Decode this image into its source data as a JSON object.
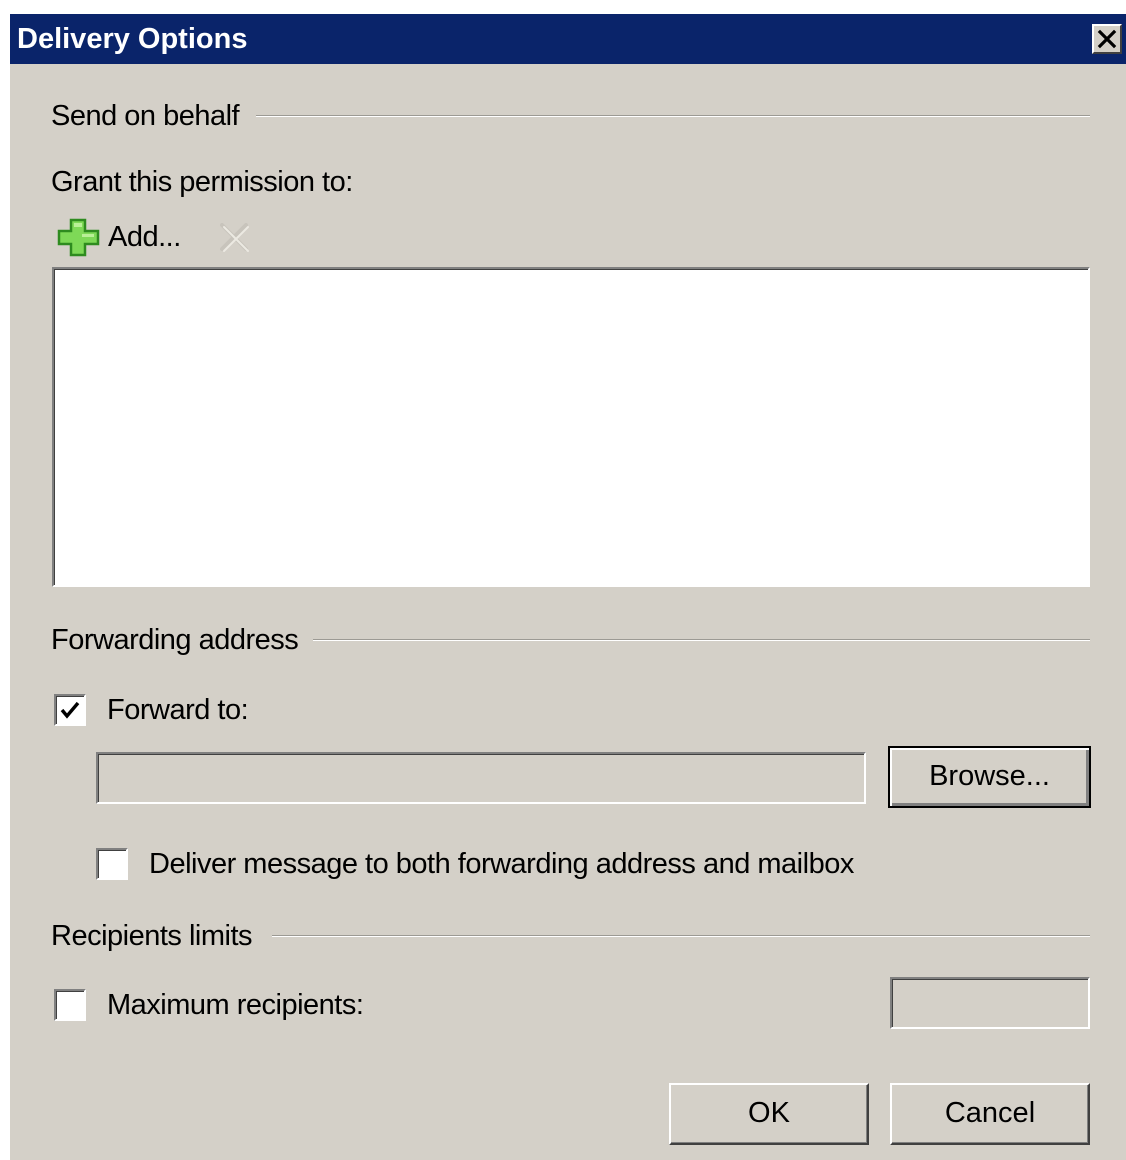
{
  "window": {
    "title": "Delivery Options",
    "close_glyph": "✕",
    "colors": {
      "titlebar": "#0a246a",
      "face": "#d4d0c8"
    }
  },
  "send_on_behalf": {
    "group_label": "Send on behalf",
    "grant_label": "Grant this permission to:",
    "add_label": "Add...",
    "add_icon": "green-plus-icon",
    "remove_icon": "remove-x-icon",
    "remove_enabled": false,
    "list_items": []
  },
  "forwarding": {
    "group_label": "Forwarding address",
    "forward_to_label": "Forward to:",
    "forward_to_checked": true,
    "forward_to_value": "",
    "browse_label": "Browse...",
    "deliver_both_label": "Deliver message to both forwarding address and mailbox",
    "deliver_both_checked": false
  },
  "recipients": {
    "group_label": "Recipients limits",
    "max_label": "Maximum recipients:",
    "max_checked": false,
    "max_value": ""
  },
  "buttons": {
    "ok_label": "OK",
    "cancel_label": "Cancel"
  }
}
